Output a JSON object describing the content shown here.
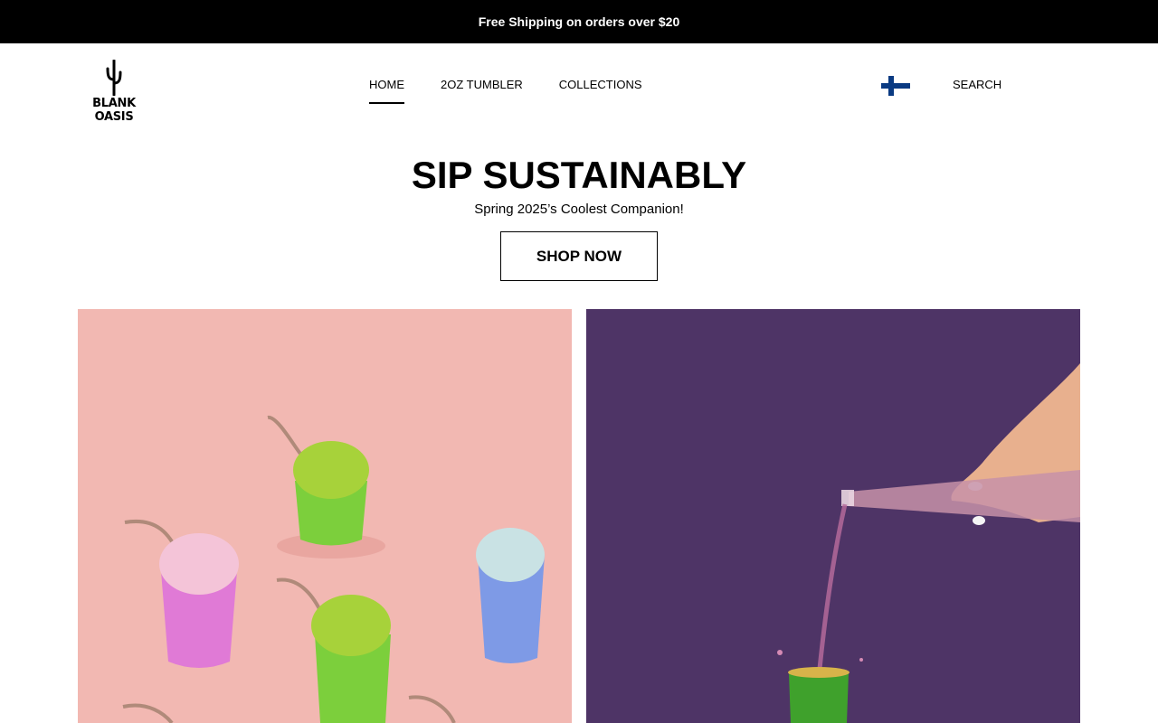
{
  "announcement": {
    "text": "Free Shipping on orders over $20"
  },
  "header": {
    "logo_text": "BLANK OASIS",
    "nav": [
      {
        "label": "HOME",
        "active": true
      },
      {
        "label": "2OZ TUMBLER",
        "active": false
      },
      {
        "label": "COLLECTIONS",
        "active": false
      }
    ],
    "flag_icon": "finland-flag-icon",
    "search_label": "SEARCH"
  },
  "hero": {
    "title": "SIP SUSTAINABLY",
    "subtitle": "Spring 2025’s Coolest Companion!",
    "cta_label": "SHOP NOW"
  },
  "promos": [
    {
      "scene": "ice-cream-tumblers-image",
      "background": "#f2b8b2"
    },
    {
      "scene": "pouring-drink-image",
      "background": "#4e3466"
    }
  ]
}
